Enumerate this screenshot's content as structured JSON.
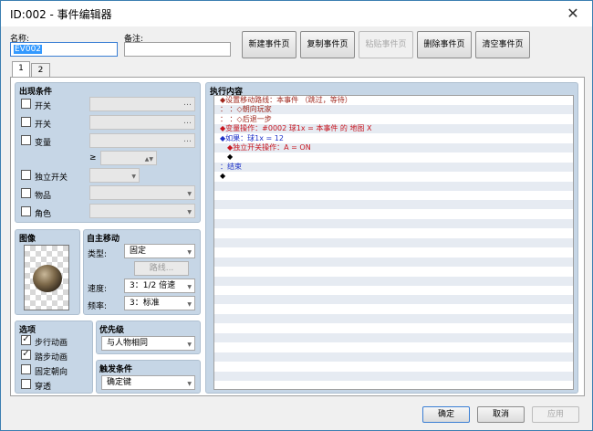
{
  "window": {
    "title": "ID:002 - 事件编辑器",
    "close_glyph": "✕"
  },
  "header": {
    "name_label": "名称:",
    "name_value": "EV002",
    "note_label": "备注:",
    "note_value": ""
  },
  "toolbar": {
    "new_page": "新建事件页",
    "copy_page": "复制事件页",
    "paste_page": "粘贴事件页",
    "delete_page": "删除事件页",
    "clear_page": "清空事件页"
  },
  "tabs": [
    "1",
    "2"
  ],
  "conditions": {
    "title": "出现条件",
    "switch1": "开关",
    "switch2": "开关",
    "variable": "变量",
    "gte": "≥",
    "self_switch": "独立开关",
    "item": "物品",
    "actor": "角色",
    "dots": "…"
  },
  "image": {
    "title": "图像"
  },
  "autonomous": {
    "title": "自主移动",
    "type_label": "类型:",
    "type_value": "固定",
    "route_button": "路线...",
    "speed_label": "速度:",
    "speed_value": "3：1/2 倍速",
    "freq_label": "频率:",
    "freq_value": "3：标准"
  },
  "options": {
    "title": "选项",
    "walking": "步行动画",
    "stepping": "踏步动画",
    "direction_fix": "固定朝向",
    "through": "穿透",
    "walking_checked": true,
    "stepping_checked": true,
    "direction_fix_checked": false,
    "through_checked": false
  },
  "priority": {
    "title": "优先级",
    "value": "与人物相同"
  },
  "trigger": {
    "title": "触发条件",
    "value": "确定键"
  },
  "contents": {
    "title": "执行内容",
    "lines": [
      {
        "text": "◆设置移动路线：本事件 （跳过，等待）",
        "color": "#a0281e",
        "indent": 0
      },
      {
        "text": "：                        ：◇朝向玩家",
        "color": "#a0281e",
        "indent": 0
      },
      {
        "text": "：                        ：◇后退一步",
        "color": "#a0281e",
        "indent": 0
      },
      {
        "text": "◆变量操作：#0002 球1x = 本事件 的 地图 X",
        "color": "#c8141e",
        "indent": 0
      },
      {
        "text": "◆如果：球1x = 12",
        "color": "#1e32c8",
        "indent": 0
      },
      {
        "text": "◆独立开关操作：A = ON",
        "color": "#c8141e",
        "indent": 1
      },
      {
        "text": "◆",
        "color": "#000000",
        "indent": 1
      },
      {
        "text": "：结束",
        "color": "#1e32c8",
        "indent": 0
      },
      {
        "text": "◆",
        "color": "#000000",
        "indent": 0
      }
    ]
  },
  "footer": {
    "ok": "确定",
    "cancel": "取消",
    "apply": "应用"
  },
  "icons": {
    "dropdown": "chevron-down-icon",
    "more": "ellipsis-icon",
    "close": "close-icon",
    "check": "checkmark-icon"
  }
}
